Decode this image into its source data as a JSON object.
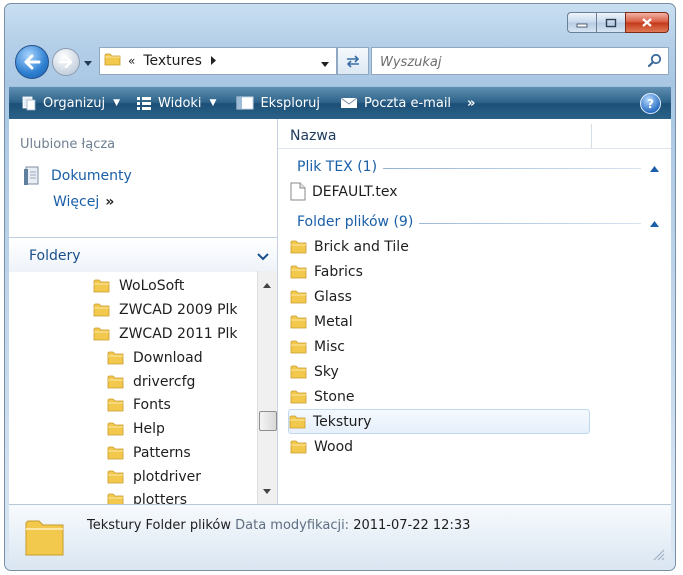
{
  "window": {
    "controls": [
      "minimize-icon",
      "maximize-icon",
      "close-icon"
    ]
  },
  "address": {
    "prefix": "«",
    "crumb": "Textures",
    "search_placeholder": "Wyszukaj"
  },
  "toolbar": {
    "organize": "Organizuj",
    "views": "Widoki",
    "explore": "Eksploruj",
    "email": "Poczta e-mail",
    "more": "»"
  },
  "favorites": {
    "title": "Ulubione łącza",
    "documents": "Dokumenty",
    "more": "Więcej",
    "more_arrow": "»"
  },
  "folders_pane": {
    "title": "Foldery",
    "tree": [
      {
        "label": "WoLoSoft",
        "level": 0
      },
      {
        "label": "ZWCAD 2009 Plk",
        "level": 0
      },
      {
        "label": "ZWCAD 2011 Plk",
        "level": 0
      },
      {
        "label": "Download",
        "level": 1
      },
      {
        "label": "drivercfg",
        "level": 1
      },
      {
        "label": "Fonts",
        "level": 1
      },
      {
        "label": "Help",
        "level": 1
      },
      {
        "label": "Patterns",
        "level": 1
      },
      {
        "label": "plotdriver",
        "level": 1
      },
      {
        "label": "plotters",
        "level": 1
      }
    ]
  },
  "file_list": {
    "column_name": "Nazwa",
    "groups": [
      {
        "label": "Plik TEX (1)",
        "items": [
          "DEFAULT.tex"
        ],
        "icon": "file-icon"
      },
      {
        "label": "Folder plików (9)",
        "items": [
          "Brick and Tile",
          "Fabrics",
          "Glass",
          "Metal",
          "Misc",
          "Sky",
          "Stone",
          "Tekstury",
          "Wood"
        ],
        "icon": "folder-icon"
      }
    ],
    "selected": "Tekstury"
  },
  "details": {
    "name": "Tekstury",
    "type": "Folder plików",
    "date_label": "Data modyfikacji:",
    "date_value": "2011-07-22 12:33"
  },
  "colors": {
    "toolbar": "#2e6389",
    "link": "#1a5fa8",
    "folder": "#f2c94c"
  }
}
